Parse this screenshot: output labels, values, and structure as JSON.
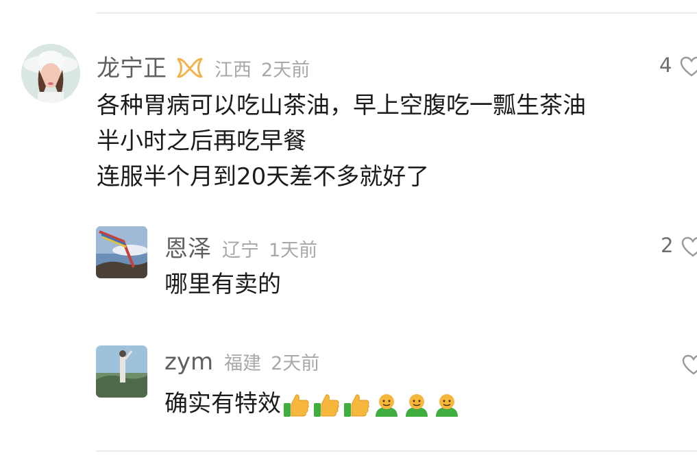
{
  "comments": [
    {
      "username": "龙宁正",
      "location": "江西",
      "time": "2天前",
      "likes": "4",
      "vip_badge": true,
      "lines": [
        "各种胃病可以吃山茶油，早上空腹吃一瓢生茶油",
        "半小时之后再吃早餐",
        "连服半个月到20天差不多就好了"
      ],
      "avatar_desc": "woman-with-white-hat",
      "icons": [
        "vip-badge-icon",
        "heart-icon"
      ]
    },
    {
      "username": "恩泽",
      "location": "辽宁",
      "time": "1天前",
      "likes": "2",
      "lines": [
        "哪里有卖的"
      ],
      "avatar_desc": "prayer-flags-landscape",
      "icons": [
        "heart-icon"
      ]
    },
    {
      "username": "zym",
      "location": "福建",
      "time": "2天前",
      "likes": "",
      "lines": [
        "确实有特效"
      ],
      "emojis": [
        "thumbs-up",
        "thumbs-up",
        "thumbs-up",
        "green-smile",
        "green-smile",
        "green-smile"
      ],
      "avatar_desc": "person-on-mountain",
      "icons": [
        "heart-icon"
      ]
    }
  ],
  "colors": {
    "username": "#5f5f5f",
    "meta": "#a8a8a8",
    "text": "#1b1b1b",
    "badge": "#f4b24d",
    "divider": "#ebebeb"
  }
}
